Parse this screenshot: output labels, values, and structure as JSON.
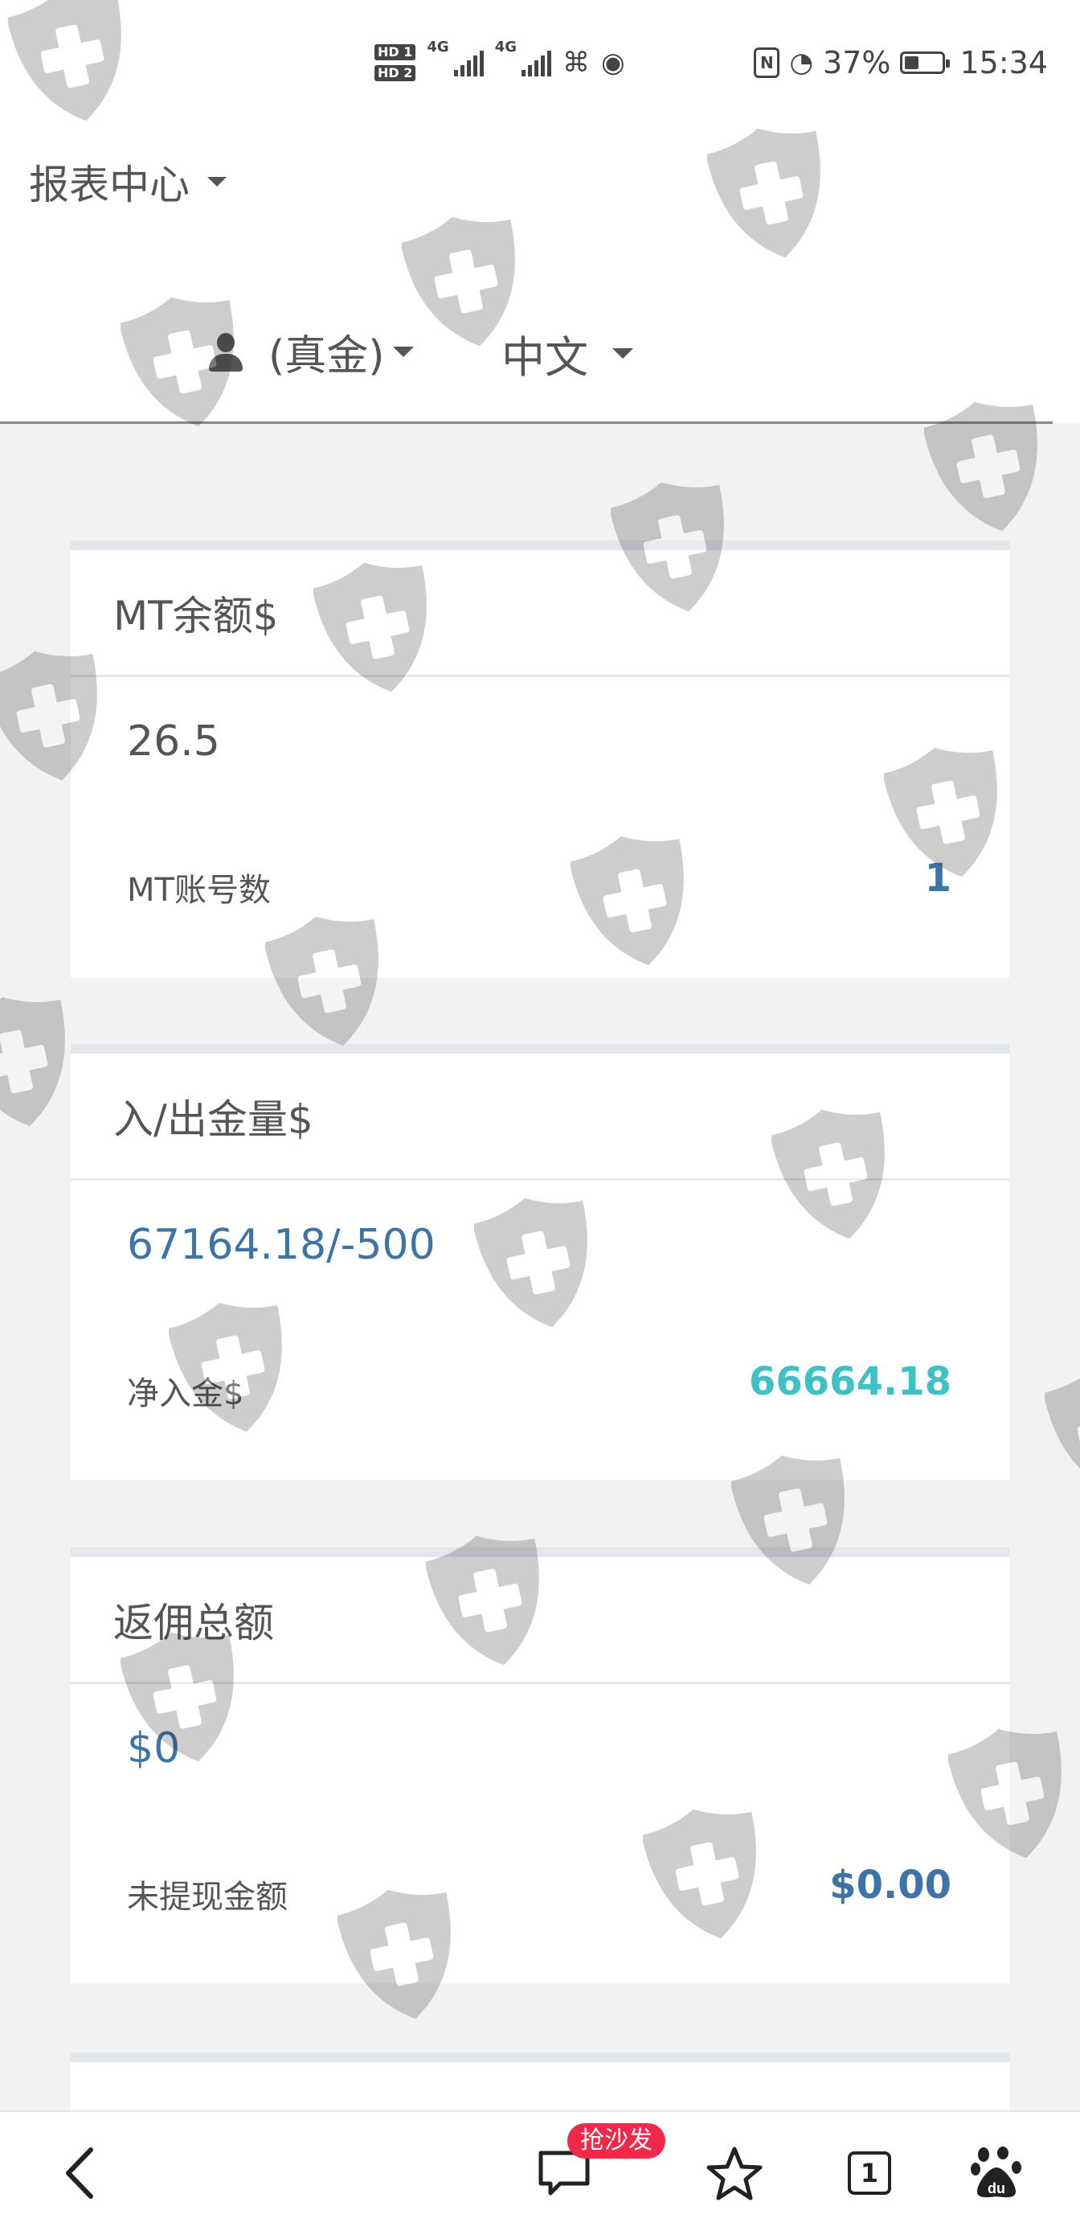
{
  "status_bar": {
    "sim1": "HD 1",
    "sim2": "HD 2",
    "net1": "4G",
    "net2": "4G",
    "nfc": "N",
    "battery_percent": "37%",
    "battery_level": 0.37,
    "time": "15:34"
  },
  "header": {
    "report_center": "报表中心",
    "account_type": "(真金)",
    "language": "中文"
  },
  "cards": [
    {
      "title": "MT余额$",
      "value": "26.5",
      "sub_label": "MT账号数",
      "sub_value": "1"
    },
    {
      "title": "入/出金量$",
      "value": "67164.18/-500",
      "sub_label": "净入金$",
      "sub_value": "66664.18"
    },
    {
      "title": "返佣总额",
      "value": "$0",
      "sub_label": "未提现金额",
      "sub_value": "$0.00"
    }
  ],
  "bottom_nav": {
    "comment_badge": "抢沙发",
    "tabs_count": "1"
  },
  "colors": {
    "accent_blue": "#3c74a8",
    "accent_teal": "#3ec1c4",
    "badge_red": "#f0294b"
  },
  "icons": [
    "user-icon",
    "back-icon",
    "comment-icon",
    "star-icon",
    "tabs-icon",
    "baidu-paw-icon",
    "shield-plus-icon"
  ]
}
